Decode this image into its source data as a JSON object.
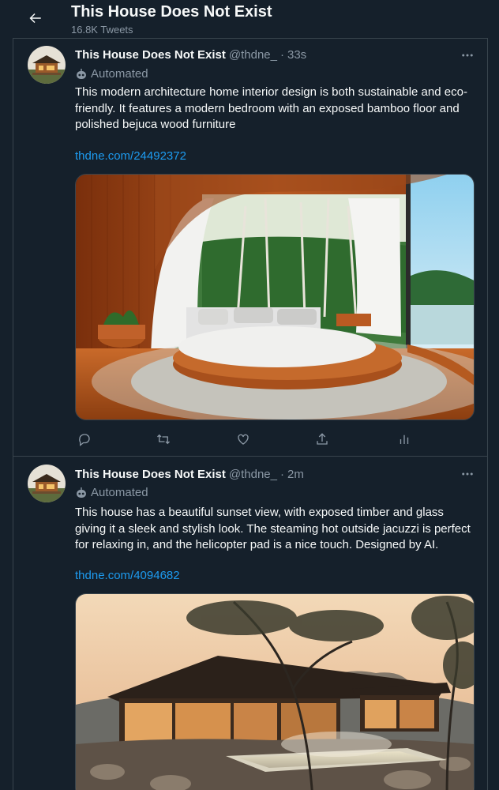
{
  "header": {
    "title": "This House Does Not Exist",
    "subtitle": "16.8K Tweets"
  },
  "tweets": [
    {
      "display_name": "This House Does Not Exist",
      "handle": "@thdne_",
      "separator": "·",
      "time": "33s",
      "automated_label": "Automated",
      "text": "This modern architecture home interior design is both sustainable and eco-friendly. It features a modern bedroom with an exposed bamboo floor and polished bejuca wood furniture",
      "link": "thdne.com/24492372",
      "image": "bedroom-interior"
    },
    {
      "display_name": "This House Does Not Exist",
      "handle": "@thdne_",
      "separator": "·",
      "time": "2m",
      "automated_label": "Automated",
      "text": "This house has a beautiful sunset view, with exposed timber and glass giving it a sleek and stylish look. The steaming hot outside jacuzzi is perfect for relaxing in, and the helicopter pad is a nice touch. Designed by AI.",
      "link": "thdne.com/4094682",
      "image": "house-exterior-sunset"
    }
  ],
  "icons": [
    "back-arrow-icon",
    "more-icon",
    "robot-icon",
    "reply-icon",
    "retweet-icon",
    "like-icon",
    "share-icon",
    "analytics-icon"
  ],
  "colors": {
    "background": "#15202b",
    "text": "#f7f9f9",
    "secondary": "#8b98a5",
    "link": "#1d9bf0",
    "border": "#38444d"
  }
}
